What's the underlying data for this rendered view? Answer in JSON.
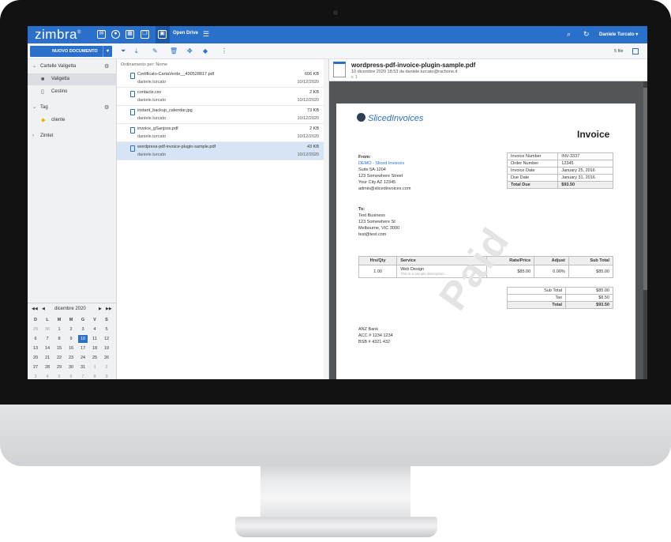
{
  "topbar": {
    "logo": "zimbra",
    "open_drive": "Open Drive",
    "user": "Daniele Turcato ▾"
  },
  "toolbar": {
    "new_doc": "NUOVO DOCUMENTO",
    "file_count": "5 file"
  },
  "sidebar": {
    "folders_header": "Cartelle Valigetta",
    "items": [
      {
        "label": "Valigetta"
      },
      {
        "label": "Cestino"
      }
    ],
    "tag_header": "Tag",
    "tags": [
      {
        "label": "cliente"
      }
    ],
    "zimlet": "Zimlet"
  },
  "calendar": {
    "title": "dicembre 2020",
    "dow": [
      "D",
      "L",
      "M",
      "M",
      "G",
      "V",
      "S"
    ],
    "weeks": [
      [
        "29",
        "30",
        "1",
        "2",
        "3",
        "4",
        "5"
      ],
      [
        "6",
        "7",
        "8",
        "9",
        "10",
        "11",
        "12"
      ],
      [
        "13",
        "14",
        "15",
        "16",
        "17",
        "18",
        "19"
      ],
      [
        "20",
        "21",
        "22",
        "23",
        "24",
        "25",
        "26"
      ],
      [
        "27",
        "28",
        "29",
        "30",
        "31",
        "1",
        "2"
      ],
      [
        "3",
        "4",
        "5",
        "6",
        "7",
        "8",
        "9"
      ]
    ],
    "today": "10"
  },
  "list": {
    "sort_label": "Ordinamento per: Nome",
    "files": [
      {
        "name": "Certificato-CartaVerde__400528817.pdf",
        "owner": "daniele.turcato",
        "size": "606 KB",
        "date": "10/12/2020"
      },
      {
        "name": "contacts.csv",
        "owner": "daniele.turcato",
        "size": "2 KB",
        "date": "10/12/2020"
      },
      {
        "name": "instant_backup_calendar.jpg",
        "owner": "daniele.turcato",
        "size": "73 KB",
        "date": "10/12/2020"
      },
      {
        "name": "invoice_gSanjsss.pdf",
        "owner": "daniele.turcato",
        "size": "2 KB",
        "date": "10/12/2020"
      },
      {
        "name": "wordpress-pdf-invoice-plugin-sample.pdf",
        "owner": "daniele.turcato",
        "size": "43 KB",
        "date": "10/12/2020"
      }
    ]
  },
  "preview": {
    "title": "wordpress-pdf-invoice-plugin-sample.pdf",
    "subtitle": "10 dicembre 2020 18:53 da daniele.turcato@rachone.it",
    "version": "v. 1"
  },
  "invoice": {
    "brand": "SlicedInvoices",
    "title": "Invoice",
    "from_label": "From:",
    "from_company": "DEMO - Sliced Invoices",
    "from_lines": [
      "Suite 5A-1204",
      "123 Somewhere Street",
      "Your City AZ 12345",
      "admin@slicedinvoices.com"
    ],
    "to_label": "To:",
    "to_lines": [
      "Test Business",
      "123 Somewhere St",
      "Melbourne, VIC 3000",
      "test@test.com"
    ],
    "meta": [
      {
        "k": "Invoice Number",
        "v": "INV-3337"
      },
      {
        "k": "Order Number",
        "v": "12345"
      },
      {
        "k": "Invoice Date",
        "v": "January 25, 2016"
      },
      {
        "k": "Due Date",
        "v": "January 31, 2016"
      },
      {
        "k": "Total Due",
        "v": "$93.50"
      }
    ],
    "svc_headers": {
      "qty": "Hrs/Qty",
      "service": "Service",
      "rate": "Rate/Price",
      "adjust": "Adjust",
      "subtotal": "Sub Total"
    },
    "svc_row": {
      "qty": "1.00",
      "service": "Web Design",
      "desc": "This is a sample description...",
      "rate": "$85.00",
      "adjust": "0.00%",
      "subtotal": "$85.00"
    },
    "totals": [
      {
        "k": "Sub Total",
        "v": "$85.00"
      },
      {
        "k": "Tax",
        "v": "$8.50"
      },
      {
        "k": "Total",
        "v": "$93.50"
      }
    ],
    "bank_lines": [
      "ANZ Bank",
      "ACC # 1234 1234",
      "BSB # 4321 432"
    ],
    "watermark": "Paid"
  }
}
